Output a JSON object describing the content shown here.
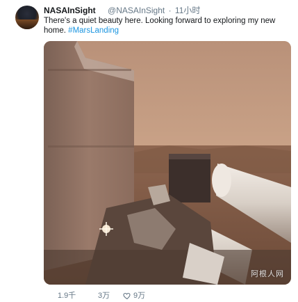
{
  "tweet": {
    "display_name": "NASAInSight",
    "handle": "@NASAInSight",
    "separator": "·",
    "time": "11小时",
    "text": "There's a quiet beauty here. Looking forward to exploring my new home.",
    "hashtag": "#MarsLanding",
    "image_watermark": "阿根人网"
  },
  "actions": {
    "reply_count": "1.9千",
    "retweet_count": "3万",
    "like_count": "9万"
  },
  "icons": {
    "like": "heart-icon"
  },
  "colors": {
    "link": "#1b95e0",
    "secondary_text": "#657786",
    "sky": "#c79f84"
  }
}
